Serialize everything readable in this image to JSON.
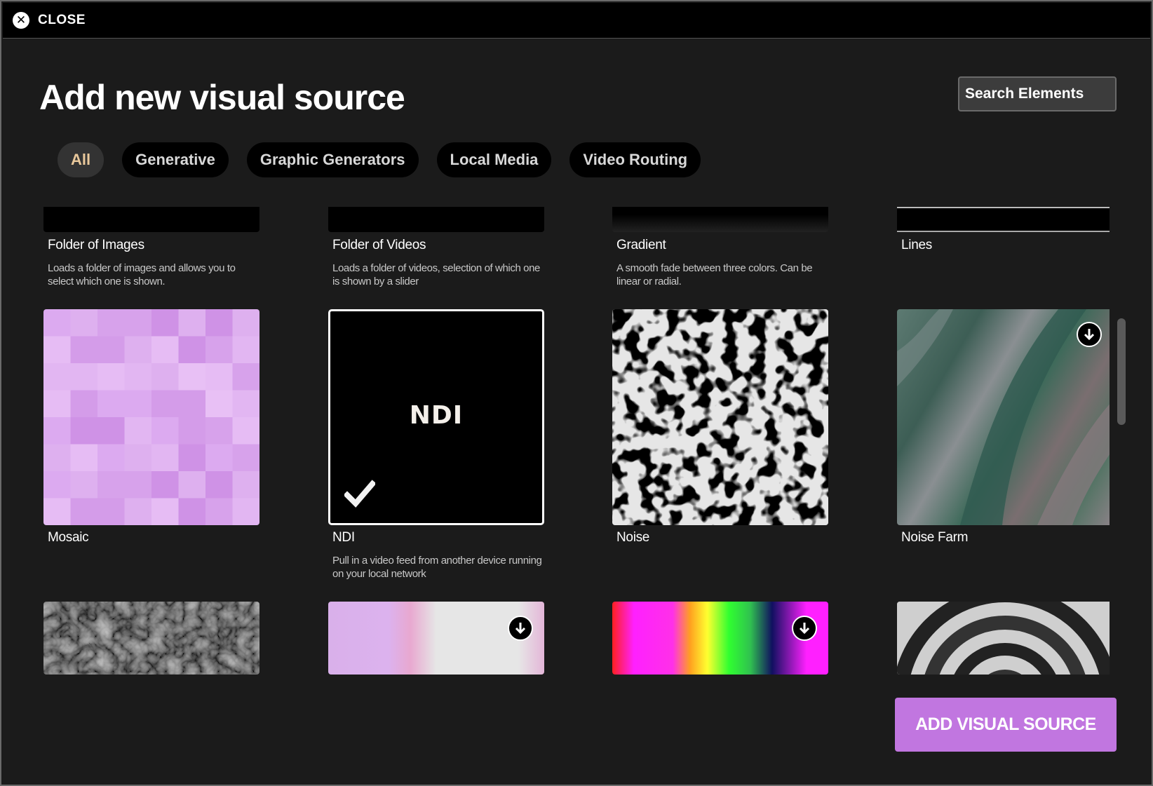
{
  "titlebar": {
    "close_label": "CLOSE",
    "close_icon": "close-icon"
  },
  "header": {
    "title": "Add new visual source",
    "search_placeholder": "Search Elements"
  },
  "tabs": [
    {
      "label": "All",
      "active": true
    },
    {
      "label": "Generative"
    },
    {
      "label": "Graphic Generators"
    },
    {
      "label": "Local Media"
    },
    {
      "label": "Video Routing"
    }
  ],
  "cards": [
    {
      "title": "Folder of Images",
      "description": "Loads a folder of images and allows you to select which one is shown."
    },
    {
      "title": "Folder of Videos",
      "description": "Loads a folder of videos, selection of which one is shown by a slider"
    },
    {
      "title": "Gradient",
      "description": "A smooth fade between three colors. Can be linear or radial."
    },
    {
      "title": "Lines",
      "description": ""
    },
    {
      "title": "Mosaic",
      "description": ""
    },
    {
      "title": "NDI",
      "description": "Pull in a video feed from another device running on your local network",
      "thumb_text": "NDI",
      "selected": true
    },
    {
      "title": "Noise",
      "description": ""
    },
    {
      "title": "Noise Farm",
      "description": "",
      "download_icon": "download-icon"
    }
  ],
  "footer": {
    "add_button_label": "ADD VISUAL SOURCE"
  },
  "colors": {
    "accent": "#c176e0",
    "active_tab_text": "#e9c89b",
    "background": "#1b1b1b"
  }
}
